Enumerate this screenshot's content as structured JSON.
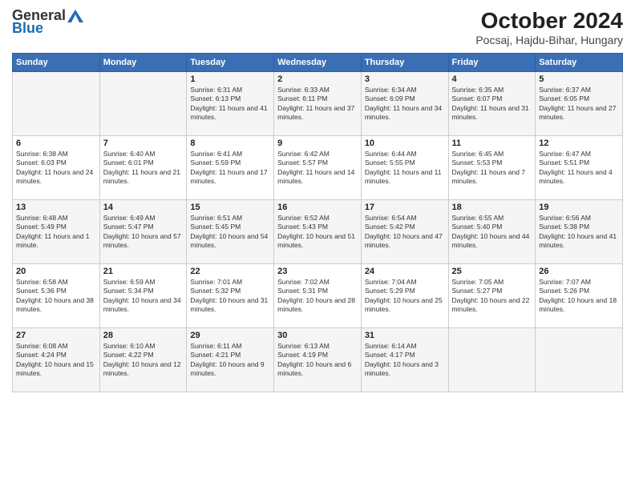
{
  "logo": {
    "general": "General",
    "blue": "Blue"
  },
  "title": "October 2024",
  "subtitle": "Pocsaj, Hajdu-Bihar, Hungary",
  "headers": [
    "Sunday",
    "Monday",
    "Tuesday",
    "Wednesday",
    "Thursday",
    "Friday",
    "Saturday"
  ],
  "weeks": [
    [
      {
        "day": "",
        "info": ""
      },
      {
        "day": "",
        "info": ""
      },
      {
        "day": "1",
        "info": "Sunrise: 6:31 AM\nSunset: 6:13 PM\nDaylight: 11 hours and 41 minutes."
      },
      {
        "day": "2",
        "info": "Sunrise: 6:33 AM\nSunset: 6:11 PM\nDaylight: 11 hours and 37 minutes."
      },
      {
        "day": "3",
        "info": "Sunrise: 6:34 AM\nSunset: 6:09 PM\nDaylight: 11 hours and 34 minutes."
      },
      {
        "day": "4",
        "info": "Sunrise: 6:35 AM\nSunset: 6:07 PM\nDaylight: 11 hours and 31 minutes."
      },
      {
        "day": "5",
        "info": "Sunrise: 6:37 AM\nSunset: 6:05 PM\nDaylight: 11 hours and 27 minutes."
      }
    ],
    [
      {
        "day": "6",
        "info": "Sunrise: 6:38 AM\nSunset: 6:03 PM\nDaylight: 11 hours and 24 minutes."
      },
      {
        "day": "7",
        "info": "Sunrise: 6:40 AM\nSunset: 6:01 PM\nDaylight: 11 hours and 21 minutes."
      },
      {
        "day": "8",
        "info": "Sunrise: 6:41 AM\nSunset: 5:59 PM\nDaylight: 11 hours and 17 minutes."
      },
      {
        "day": "9",
        "info": "Sunrise: 6:42 AM\nSunset: 5:57 PM\nDaylight: 11 hours and 14 minutes."
      },
      {
        "day": "10",
        "info": "Sunrise: 6:44 AM\nSunset: 5:55 PM\nDaylight: 11 hours and 11 minutes."
      },
      {
        "day": "11",
        "info": "Sunrise: 6:45 AM\nSunset: 5:53 PM\nDaylight: 11 hours and 7 minutes."
      },
      {
        "day": "12",
        "info": "Sunrise: 6:47 AM\nSunset: 5:51 PM\nDaylight: 11 hours and 4 minutes."
      }
    ],
    [
      {
        "day": "13",
        "info": "Sunrise: 6:48 AM\nSunset: 5:49 PM\nDaylight: 11 hours and 1 minute."
      },
      {
        "day": "14",
        "info": "Sunrise: 6:49 AM\nSunset: 5:47 PM\nDaylight: 10 hours and 57 minutes."
      },
      {
        "day": "15",
        "info": "Sunrise: 6:51 AM\nSunset: 5:45 PM\nDaylight: 10 hours and 54 minutes."
      },
      {
        "day": "16",
        "info": "Sunrise: 6:52 AM\nSunset: 5:43 PM\nDaylight: 10 hours and 51 minutes."
      },
      {
        "day": "17",
        "info": "Sunrise: 6:54 AM\nSunset: 5:42 PM\nDaylight: 10 hours and 47 minutes."
      },
      {
        "day": "18",
        "info": "Sunrise: 6:55 AM\nSunset: 5:40 PM\nDaylight: 10 hours and 44 minutes."
      },
      {
        "day": "19",
        "info": "Sunrise: 6:56 AM\nSunset: 5:38 PM\nDaylight: 10 hours and 41 minutes."
      }
    ],
    [
      {
        "day": "20",
        "info": "Sunrise: 6:58 AM\nSunset: 5:36 PM\nDaylight: 10 hours and 38 minutes."
      },
      {
        "day": "21",
        "info": "Sunrise: 6:59 AM\nSunset: 5:34 PM\nDaylight: 10 hours and 34 minutes."
      },
      {
        "day": "22",
        "info": "Sunrise: 7:01 AM\nSunset: 5:32 PM\nDaylight: 10 hours and 31 minutes."
      },
      {
        "day": "23",
        "info": "Sunrise: 7:02 AM\nSunset: 5:31 PM\nDaylight: 10 hours and 28 minutes."
      },
      {
        "day": "24",
        "info": "Sunrise: 7:04 AM\nSunset: 5:29 PM\nDaylight: 10 hours and 25 minutes."
      },
      {
        "day": "25",
        "info": "Sunrise: 7:05 AM\nSunset: 5:27 PM\nDaylight: 10 hours and 22 minutes."
      },
      {
        "day": "26",
        "info": "Sunrise: 7:07 AM\nSunset: 5:26 PM\nDaylight: 10 hours and 18 minutes."
      }
    ],
    [
      {
        "day": "27",
        "info": "Sunrise: 6:08 AM\nSunset: 4:24 PM\nDaylight: 10 hours and 15 minutes."
      },
      {
        "day": "28",
        "info": "Sunrise: 6:10 AM\nSunset: 4:22 PM\nDaylight: 10 hours and 12 minutes."
      },
      {
        "day": "29",
        "info": "Sunrise: 6:11 AM\nSunset: 4:21 PM\nDaylight: 10 hours and 9 minutes."
      },
      {
        "day": "30",
        "info": "Sunrise: 6:13 AM\nSunset: 4:19 PM\nDaylight: 10 hours and 6 minutes."
      },
      {
        "day": "31",
        "info": "Sunrise: 6:14 AM\nSunset: 4:17 PM\nDaylight: 10 hours and 3 minutes."
      },
      {
        "day": "",
        "info": ""
      },
      {
        "day": "",
        "info": ""
      }
    ]
  ]
}
